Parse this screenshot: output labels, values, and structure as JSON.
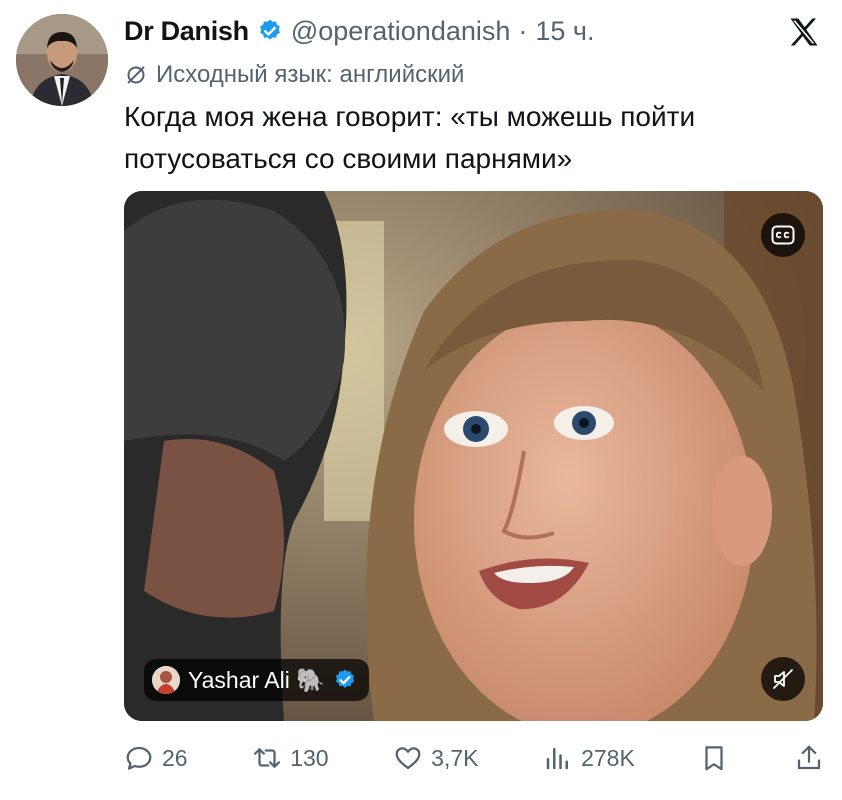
{
  "author": {
    "name": "Dr Danish",
    "handle": "@operationdanish",
    "separator": "·",
    "time": "15 ч."
  },
  "translation_note": "Исходный язык: английский",
  "tweet": {
    "text": "Когда моя жена говорит: «ты можешь пойти потусоваться со своими парнями»"
  },
  "media": {
    "credit_name": "Yashar Ali 🐘",
    "cc_label": "CC"
  },
  "actions": {
    "replies": "26",
    "retweets": "130",
    "likes": "3,7K",
    "views": "278K"
  },
  "colors": {
    "verified": "#1d9bf0",
    "text": "#0f1419",
    "secondary": "#536471"
  },
  "icons": [
    "x-logo-icon",
    "verified-icon",
    "translate-icon",
    "cc-icon",
    "mute-icon",
    "reply-icon",
    "retweet-icon",
    "like-icon",
    "views-icon",
    "bookmark-icon",
    "share-icon"
  ]
}
